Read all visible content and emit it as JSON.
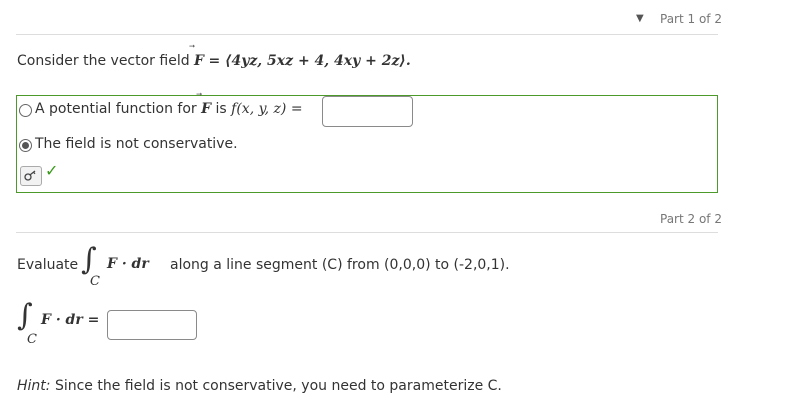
{
  "part1": {
    "caret": "▼",
    "label": "Part 1 of 2",
    "prompt": "Consider the vector field",
    "field_lhs": "F",
    "field_rhs": "= ⟨4yz, 5xz + 4, 4xy + 2z⟩.",
    "options": [
      {
        "text_before": "A potential function for",
        "field": "F",
        "text_mid": "is",
        "math": "f(x, y, z) =",
        "selected": false
      },
      {
        "text": "The field is not conservative.",
        "selected": true
      }
    ],
    "key_icon": "key-icon",
    "check_icon": "✓"
  },
  "part2": {
    "label": "Part 2 of 2",
    "evaluate": "Evaluate",
    "integral_sub": "C",
    "integrand": "F · dr",
    "description": "along a line segment (C) from (0,0,0) to (-2,0,1).",
    "answer_integrand": "F · dr =",
    "hint_label": "Hint:",
    "hint_text": "Since the field is not conservative, you need to parameterize C."
  },
  "colors": {
    "correct_border": "#4c9a2a",
    "check": "#3a9a1a"
  }
}
